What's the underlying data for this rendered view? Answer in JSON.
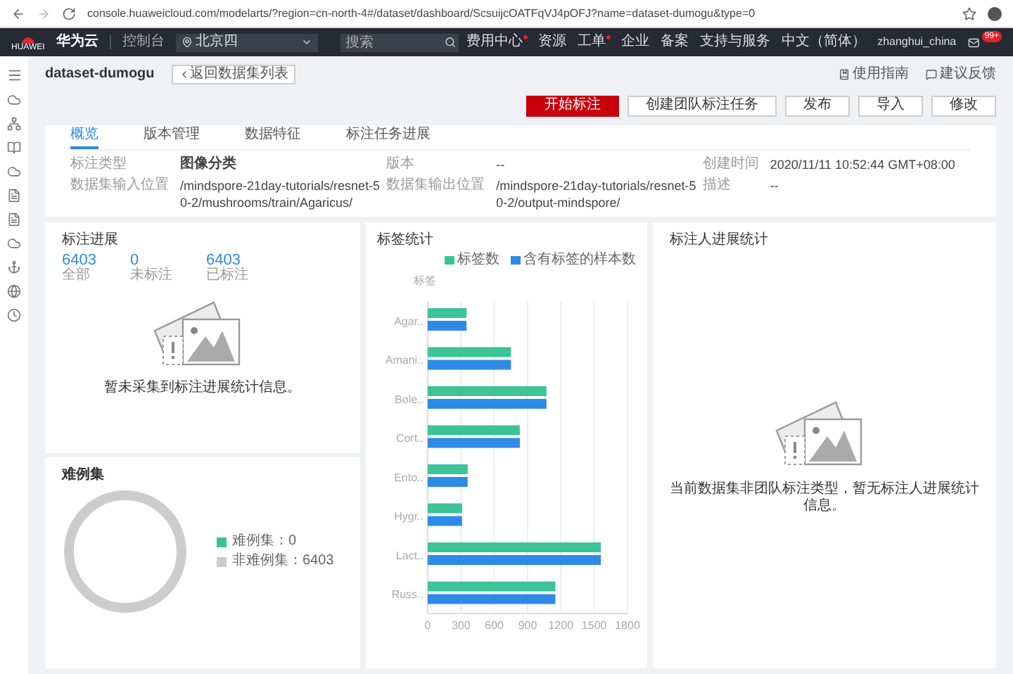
{
  "browser": {
    "url": "console.huaweicloud.com/modelarts/?region=cn-north-4#/dataset/dashboard/ScsuijcOATFqVJ4pOFJ?name=dataset-dumogu&type=0"
  },
  "navbar": {
    "logo_caption": "HUAWEI",
    "brand": "华为云",
    "console": "控制台",
    "region": "北京四",
    "search_placeholder": "搜索",
    "links": [
      {
        "label": "费用中心",
        "dot": true
      },
      {
        "label": "资源",
        "dot": false
      },
      {
        "label": "工单",
        "dot": true
      },
      {
        "label": "企业",
        "dot": false
      },
      {
        "label": "备案",
        "dot": false
      },
      {
        "label": "支持与服务",
        "dot": false
      },
      {
        "label": "中文（简体）",
        "dot": false
      }
    ],
    "user": "zhanghui_china",
    "mail_badge": "99+"
  },
  "header": {
    "title": "dataset-dumogu",
    "back": "返回数据集列表",
    "help": [
      "使用指南",
      "建议反馈"
    ]
  },
  "actions": [
    {
      "label": "开始标注",
      "primary": true
    },
    {
      "label": "创建团队标注任务",
      "primary": false
    },
    {
      "label": "发布",
      "primary": false
    },
    {
      "label": "导入",
      "primary": false
    },
    {
      "label": "修改",
      "primary": false
    }
  ],
  "tabs": [
    {
      "label": "概览",
      "selected": true
    },
    {
      "label": "版本管理",
      "selected": false
    },
    {
      "label": "数据特征",
      "selected": false
    },
    {
      "label": "标注任务进展",
      "selected": false
    }
  ],
  "info": [
    {
      "label": "标注类型",
      "value": "图像分类",
      "bold": true
    },
    {
      "label": "版本",
      "value": "--",
      "bold": false
    },
    {
      "label": "创建时间",
      "value": "2020/11/11 10:52:44 GMT+08:00",
      "bold": false
    },
    {
      "label": "数据集输入位置",
      "value": "/mindspore-21day-tutorials/resnet-50-2/mushrooms/train/Agaricus/",
      "bold": false
    },
    {
      "label": "数据集输出位置",
      "value": "/mindspore-21day-tutorials/resnet-50-2/output-mindspore/",
      "bold": false
    },
    {
      "label": "描述",
      "value": "--",
      "bold": false
    }
  ],
  "progress": {
    "title": "标注进展",
    "stats": [
      {
        "value": "6403",
        "label": "全部"
      },
      {
        "value": "0",
        "label": "未标注"
      },
      {
        "value": "6403",
        "label": "已标注"
      }
    ],
    "empty": "暂未采集到标注进展统计信息。"
  },
  "hard_examples": {
    "title": "难例集",
    "legend": [
      {
        "label": "难例集：0",
        "color": "#3cc398"
      },
      {
        "label": "非难例集：6403",
        "color": "#cccccc"
      }
    ]
  },
  "label_stats": {
    "title": "标签统计",
    "chart_data": {
      "type": "bar",
      "orientation": "horizontal",
      "ylabel": "标签",
      "categories": [
        "Agar..",
        "Amani..",
        "Bole..",
        "Cort..",
        "Ento..",
        "Hygr..",
        "Lact..",
        "Russ.."
      ],
      "series": [
        {
          "name": "标签数",
          "color": "#3cc398",
          "values": [
            350,
            750,
            1070,
            830,
            360,
            310,
            1560,
            1150
          ]
        },
        {
          "name": "含有标签的样本数",
          "color": "#2d8ae6",
          "values": [
            350,
            750,
            1070,
            830,
            360,
            310,
            1560,
            1150
          ]
        }
      ],
      "grid": true,
      "xlim": [
        0,
        1800
      ],
      "xticks": [
        0,
        300,
        600,
        900,
        1200,
        1500,
        1800
      ]
    }
  },
  "annotator": {
    "title": "标注人进展统计",
    "empty": "当前数据集非团队标注类型，暂无标注人进展统计信息。"
  }
}
